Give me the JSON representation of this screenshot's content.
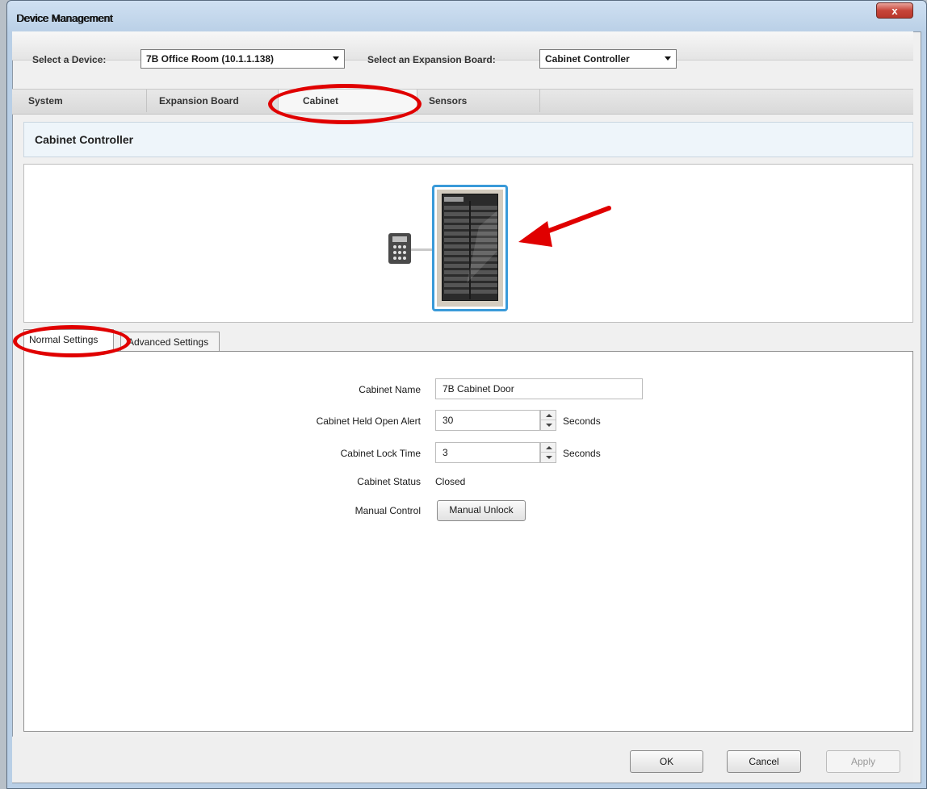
{
  "window": {
    "title": "Device Management",
    "close_glyph": "x"
  },
  "selector": {
    "device_label": "Select a Device:",
    "device_value": "7B Office Room (10.1.1.138)",
    "expansion_label": "Select an Expansion Board:",
    "expansion_value": "Cabinet Controller"
  },
  "main_tabs": [
    {
      "label": "System"
    },
    {
      "label": "Expansion Board"
    },
    {
      "label": "Cabinet"
    },
    {
      "label": "Sensors"
    }
  ],
  "section": {
    "title": "Cabinet Controller"
  },
  "sub_tabs": [
    {
      "label": "Normal Settings"
    },
    {
      "label": "Advanced Settings"
    }
  ],
  "form": {
    "cabinet_name_label": "Cabinet Name",
    "cabinet_name_value": "7B Cabinet Door",
    "held_open_label": "Cabinet Held Open Alert",
    "held_open_value": "30",
    "held_open_unit": "Seconds",
    "lock_time_label": "Cabinet Lock Time",
    "lock_time_value": "3",
    "lock_time_unit": "Seconds",
    "status_label": "Cabinet Status",
    "status_value": "Closed",
    "manual_control_label": "Manual Control",
    "manual_unlock_label": "Manual Unlock"
  },
  "buttons": {
    "ok": "OK",
    "cancel": "Cancel",
    "apply": "Apply"
  },
  "icons": {
    "keypad": "keypad-icon",
    "cabinet": "server-cabinet-icon",
    "arrow": "red-arrow-annotation"
  },
  "colors": {
    "annotation": "#e00000",
    "selection_border": "#3a9ad9"
  }
}
